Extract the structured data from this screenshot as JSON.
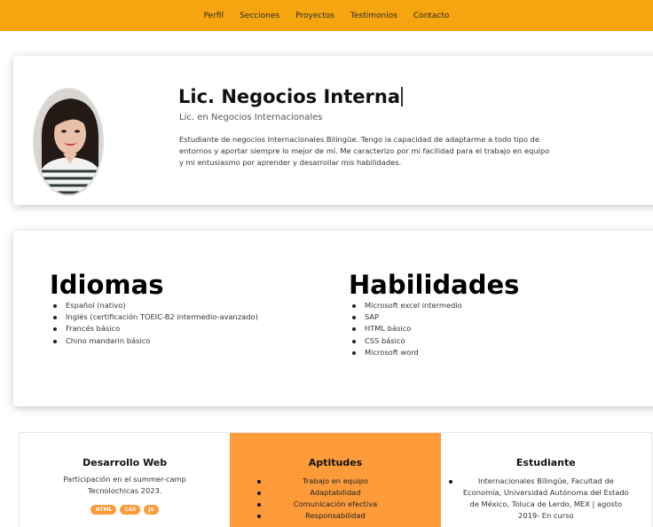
{
  "nav": {
    "items": [
      "Perfil",
      "Secciones",
      "Proyectos",
      "Testimonios",
      "Contacto"
    ]
  },
  "profile": {
    "name": "Lic. Negocios Interna",
    "subtitle": "Lic. en Negocios Internacionales",
    "bio": "Estudiante de negocios Internacionales Bilingüe. Tengo la capacidad de adaptarme a todo tipo de entornos y aportar siempre lo mejor de mí. Me caracterizo por mi facilidad para el trabajo en equipo y mi entusiasmo por aprender y desarrollar mis habilidades."
  },
  "languages": {
    "title": "Idiomas",
    "items": [
      "Español (nativo)",
      "Inglés (certificación TOEIC-B2 intermedio-avanzado)",
      "Francés básico",
      "Chino mandarin básico"
    ]
  },
  "skills": {
    "title": "Habilidades",
    "items": [
      "Microsoft excel intermedio",
      "SAP",
      "HTML básico",
      "CSS básico",
      "Microsoft word"
    ]
  },
  "tiles": {
    "web": {
      "title": "Desarrollo Web",
      "desc": "Participación en el summer-camp Tecnolochicas 2023.",
      "badges": [
        "HTML",
        "CSS",
        "JS"
      ]
    },
    "aptitudes": {
      "title": "Aptitudes",
      "items": [
        "Trabajo en equipo",
        "Adaptabilidad",
        "Comunicación efectiva",
        "Responsabilidad"
      ]
    },
    "student": {
      "title": "Estudiante",
      "text": "Internacionales Bilingüe, Facultad de Economía, Universidad Autónoma del Estado de México, Toluca de Lerdo, MEX | agosto 2019- En curso"
    }
  },
  "colors": {
    "nav": "#f5a50f",
    "accent": "#fd9b3b"
  }
}
